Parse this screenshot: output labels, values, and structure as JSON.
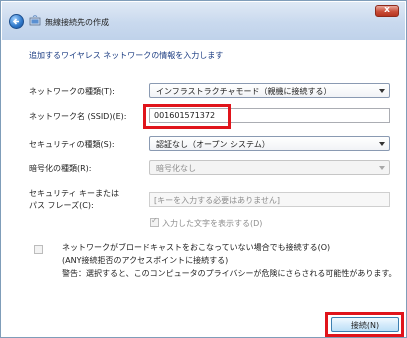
{
  "window": {
    "title": "無線接続先の作成",
    "close_label": "x"
  },
  "heading": "追加するワイヤレス ネットワークの情報を入力します",
  "form": {
    "network_type": {
      "label": "ネットワークの種類(T):",
      "value": "インフラストラクチャモード（親機に接続する）"
    },
    "network_name": {
      "label": "ネットワーク名 (SSID)(E):",
      "value": "001601571372"
    },
    "security_type": {
      "label": "セキュリティの種類(S):",
      "value": "認証なし（オープン システム）"
    },
    "encryption_type": {
      "label": "暗号化の種類(R):",
      "value": "暗号化なし"
    },
    "security_key": {
      "label_line1": "セキュリティ キーまたは",
      "label_line2": "パス フレーズ(C):",
      "placeholder": "[キーを入力する必要はありません]"
    },
    "show_chars": {
      "label": "入力した文字を表示する(D)",
      "checked": true
    }
  },
  "broadcast_option": {
    "label": "ネットワークがブロードキャストをおこなっていない場合でも接続する(O)",
    "sub_label": "(ANY接続拒否のアクセスポイントに接続する)",
    "warning": "警告：選択すると、このコンピュータのプライバシーが危険にさらされる可能性があります。",
    "checked": false
  },
  "buttons": {
    "connect": "接続(N)"
  },
  "colors": {
    "highlight": "#e0141b",
    "heading_text": "#1b3c82",
    "titlebar": "#c9d9ee"
  }
}
